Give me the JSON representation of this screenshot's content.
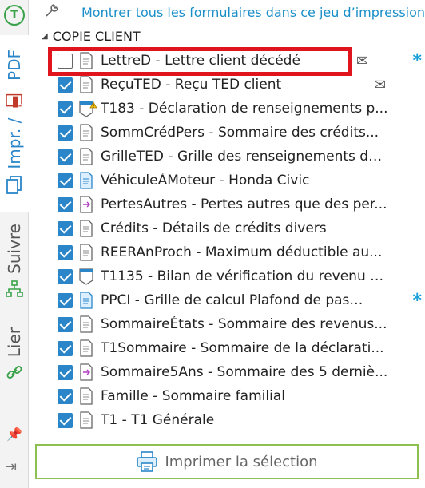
{
  "rail": {
    "top_badge": "T",
    "tabs": [
      {
        "id": "impr",
        "label": "Impr. / PDF",
        "active": true
      },
      {
        "id": "suivre",
        "label": "Suivre",
        "active": false
      },
      {
        "id": "lier",
        "label": "Lier",
        "active": false
      }
    ],
    "impr_label": "Impr. /",
    "pdf_label": "PDF",
    "suivre_label": "Suivre",
    "lier_label": "Lier"
  },
  "header": {
    "show_all_link": "Montrer tous les formulaires dans ce jeu d’impression..."
  },
  "group": {
    "title": "COPIE CLIENT"
  },
  "forms": [
    {
      "label": "LettreD - Lettre client décédé",
      "checked": false,
      "icon": "document-icon",
      "envelope": true,
      "star": true,
      "highlighted": true
    },
    {
      "label": "ReçuTED - Reçu TED client",
      "checked": true,
      "icon": "document-icon",
      "envelope": true,
      "star": false
    },
    {
      "label": "T183 - Déclaration de renseignements p...",
      "checked": true,
      "icon": "shield-form-icon",
      "warning": true
    },
    {
      "label": "SommCrédPers - Sommaire des crédits...",
      "checked": true,
      "icon": "document-icon"
    },
    {
      "label": "GrilleTED - Grille des renseignements de...",
      "checked": true,
      "icon": "document-icon"
    },
    {
      "label": "VéhiculeÀMoteur - Honda Civic",
      "checked": true,
      "icon": "blue-document-icon"
    },
    {
      "label": "PertesAutres - Pertes autres que des per...",
      "checked": true,
      "icon": "arrow-document-icon"
    },
    {
      "label": "Crédits - Détails de crédits divers",
      "checked": true,
      "icon": "document-icon"
    },
    {
      "label": "REERAnProch - Maximum déductible au...",
      "checked": true,
      "icon": "document-icon"
    },
    {
      "label": "T1135 - Bilan de vérification du revenu é...",
      "checked": true,
      "icon": "shield-form-icon"
    },
    {
      "label": "PPCI - Grille de calcul Plafond de pass...",
      "checked": true,
      "icon": "blue-document-icon",
      "star": true
    },
    {
      "label": "SommaireÉtats - Sommaire des revenus...",
      "checked": true,
      "icon": "document-icon"
    },
    {
      "label": "T1Sommaire - Sommaire de la déclarati...",
      "checked": true,
      "icon": "document-icon"
    },
    {
      "label": "Sommaire5Ans - Sommaire des 5 derniè...",
      "checked": true,
      "icon": "arrow-document-icon"
    },
    {
      "label": "Famille - Sommaire familial",
      "checked": true,
      "icon": "document-icon"
    },
    {
      "label": "T1 - T1 Générale",
      "checked": true,
      "icon": "document-icon"
    }
  ],
  "footer": {
    "print_button": "Imprimer la sélection"
  },
  "colors": {
    "accent": "#2a86c8",
    "link": "#1a8fc9",
    "highlight": "#e0141c",
    "button_border": "#8cc152",
    "star": "#1aa0d8"
  }
}
